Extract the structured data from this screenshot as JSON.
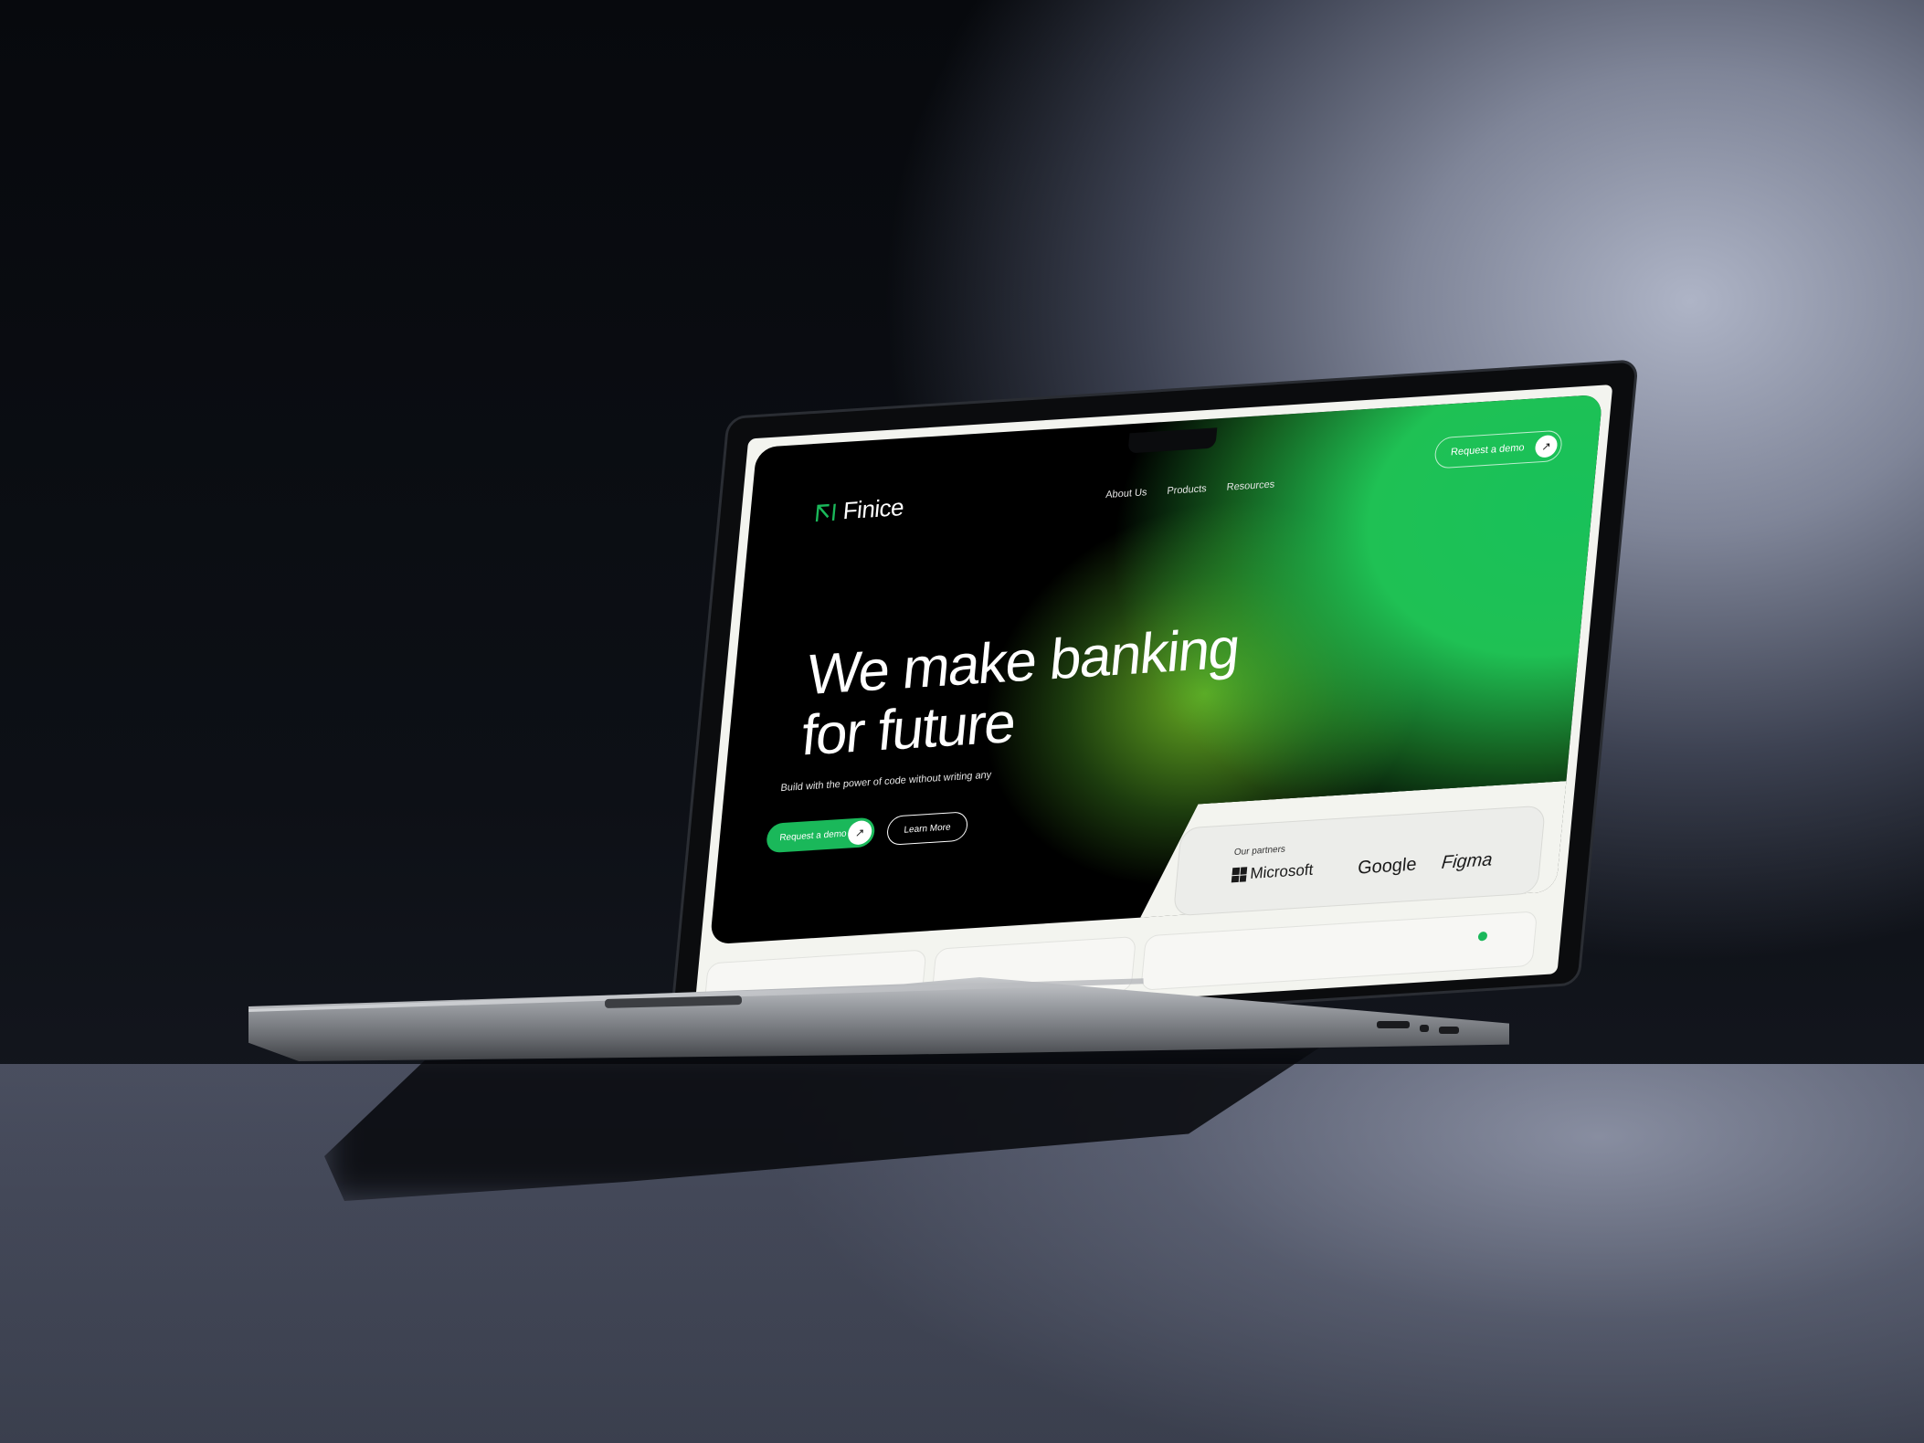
{
  "brand": {
    "name": "Finice"
  },
  "nav": {
    "items": [
      "About Us",
      "Products",
      "Resources"
    ]
  },
  "header": {
    "cta_label": "Request a demo"
  },
  "hero": {
    "headline_line1": "We make banking",
    "headline_line2": "for future",
    "subtitle": "Build with the power of code without writing any",
    "primary_button": "Request a demo",
    "secondary_button": "Learn More"
  },
  "partners": {
    "label": "Our partners",
    "items": [
      "Microsoft",
      "Google",
      "Figma"
    ]
  },
  "colors": {
    "accent": "#1ab85a",
    "hero_bg": "#000000",
    "page_bg": "#f3f4ef"
  },
  "icons": {
    "logo": "finice-logo-mark",
    "cta_arrow": "arrow-up-right-icon",
    "microsoft": "microsoft-logo-icon"
  }
}
